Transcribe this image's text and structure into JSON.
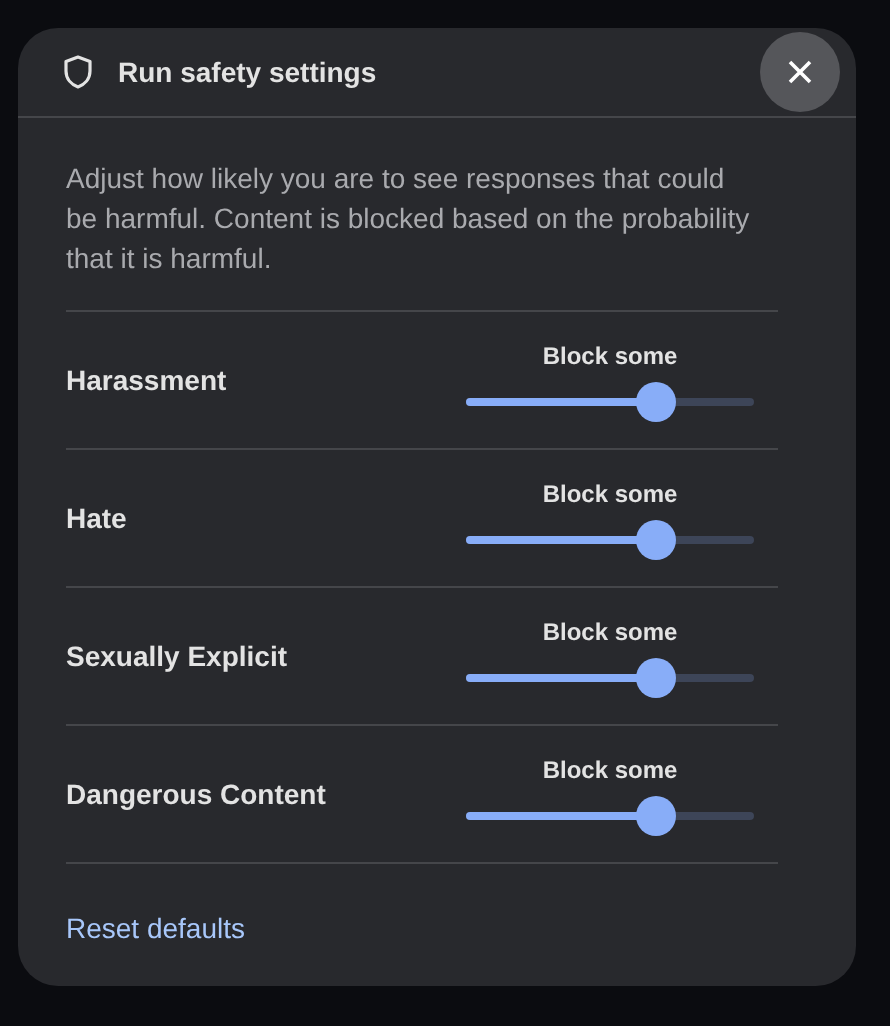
{
  "dialog": {
    "title": "Run safety settings",
    "description": "Adjust how likely you are to see responses that could be harmful. Content is blocked based on the probability that it is harmful.",
    "settings": [
      {
        "label": "Harassment",
        "reading": "Block some",
        "level": 0.66
      },
      {
        "label": "Hate",
        "reading": "Block some",
        "level": 0.66
      },
      {
        "label": "Sexually Explicit",
        "reading": "Block some",
        "level": 0.66
      },
      {
        "label": "Dangerous Content",
        "reading": "Block some",
        "level": 0.66
      }
    ],
    "reset_link": "Reset defaults"
  }
}
